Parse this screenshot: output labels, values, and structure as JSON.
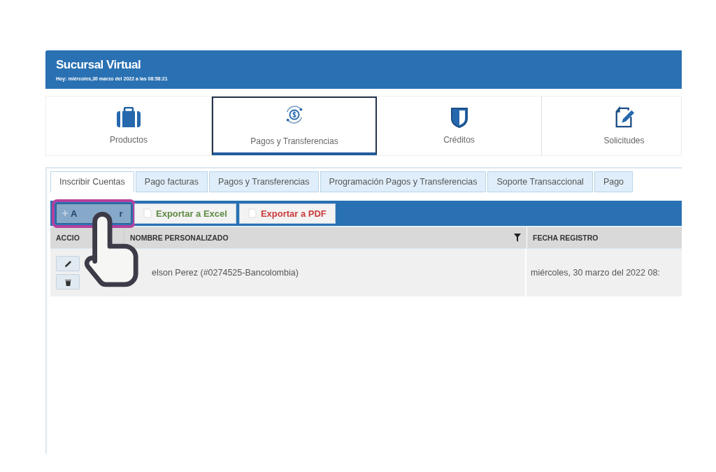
{
  "header": {
    "title": "Sucursal Virtual",
    "subtitle": "Hoy: miércoles,30 marzo del 2022 a las 08:58:21"
  },
  "nav": [
    {
      "label": "Productos",
      "selected": false
    },
    {
      "label": "Pagos y Transferencias",
      "selected": true
    },
    {
      "label": "Créditos",
      "selected": false
    },
    {
      "label": "Solicitudes",
      "selected": false
    }
  ],
  "tabs": [
    {
      "label": "Inscribir Cuentas",
      "selected": true
    },
    {
      "label": "Pago facturas",
      "selected": false
    },
    {
      "label": "Pagos y Transferencias",
      "selected": false
    },
    {
      "label": "Programación Pagos y Transferencias",
      "selected": false
    },
    {
      "label": "Soporte Transaccional",
      "selected": false
    },
    {
      "label": "Pago",
      "selected": false
    }
  ],
  "toolbar": {
    "buttons": [
      {
        "kind": "add",
        "label_parts": [
          "A",
          "r"
        ],
        "highlighted": true
      },
      {
        "kind": "excel",
        "label": "Exportar a Excel",
        "highlighted": false
      },
      {
        "kind": "pdf",
        "label": "Exportar a PDF",
        "highlighted": false
      }
    ]
  },
  "table": {
    "columns": [
      {
        "label": "ACCIO",
        "filter": false
      },
      {
        "label": "NOMBRE PERSONALIZADO",
        "filter": true
      },
      {
        "label": "FECHA REGISTRO",
        "filter": false
      }
    ],
    "rows": [
      {
        "cells": [
          "",
          "elson Perez (#0274525-Bancolombia)",
          "miércoles, 30 marzo del 2022 08:"
        ]
      }
    ]
  },
  "cursor": {
    "kind": "hand"
  }
}
